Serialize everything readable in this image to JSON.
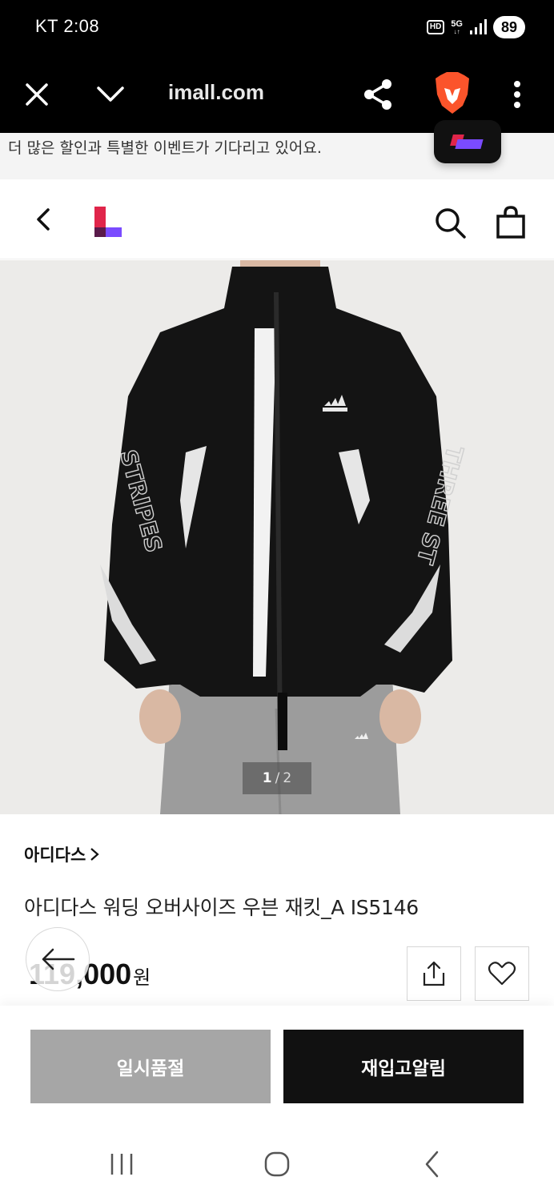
{
  "status_bar": {
    "carrier_time": "KT 2:08",
    "hd_label": "HD",
    "network_label": "5G",
    "battery": "89"
  },
  "browser": {
    "url": "imall.com"
  },
  "promo": {
    "text": "더 많은 할인과 특별한 이벤트가 기다리고 있어요."
  },
  "gallery": {
    "current": "1",
    "separator": "/",
    "total": "2"
  },
  "product": {
    "brand": "아디다스",
    "title": "아디다스 워딩 오버사이즈 우븐 재킷_A IS5146",
    "price": "119,000",
    "currency": "원"
  },
  "actions": {
    "soldout_label": "일시품절",
    "restock_label": "재입고알림"
  },
  "colors": {
    "brand_red": "#e0254a",
    "brand_purple": "#7a4bff",
    "soldout_gray": "#a6a6a6",
    "primary_black": "#111111"
  }
}
